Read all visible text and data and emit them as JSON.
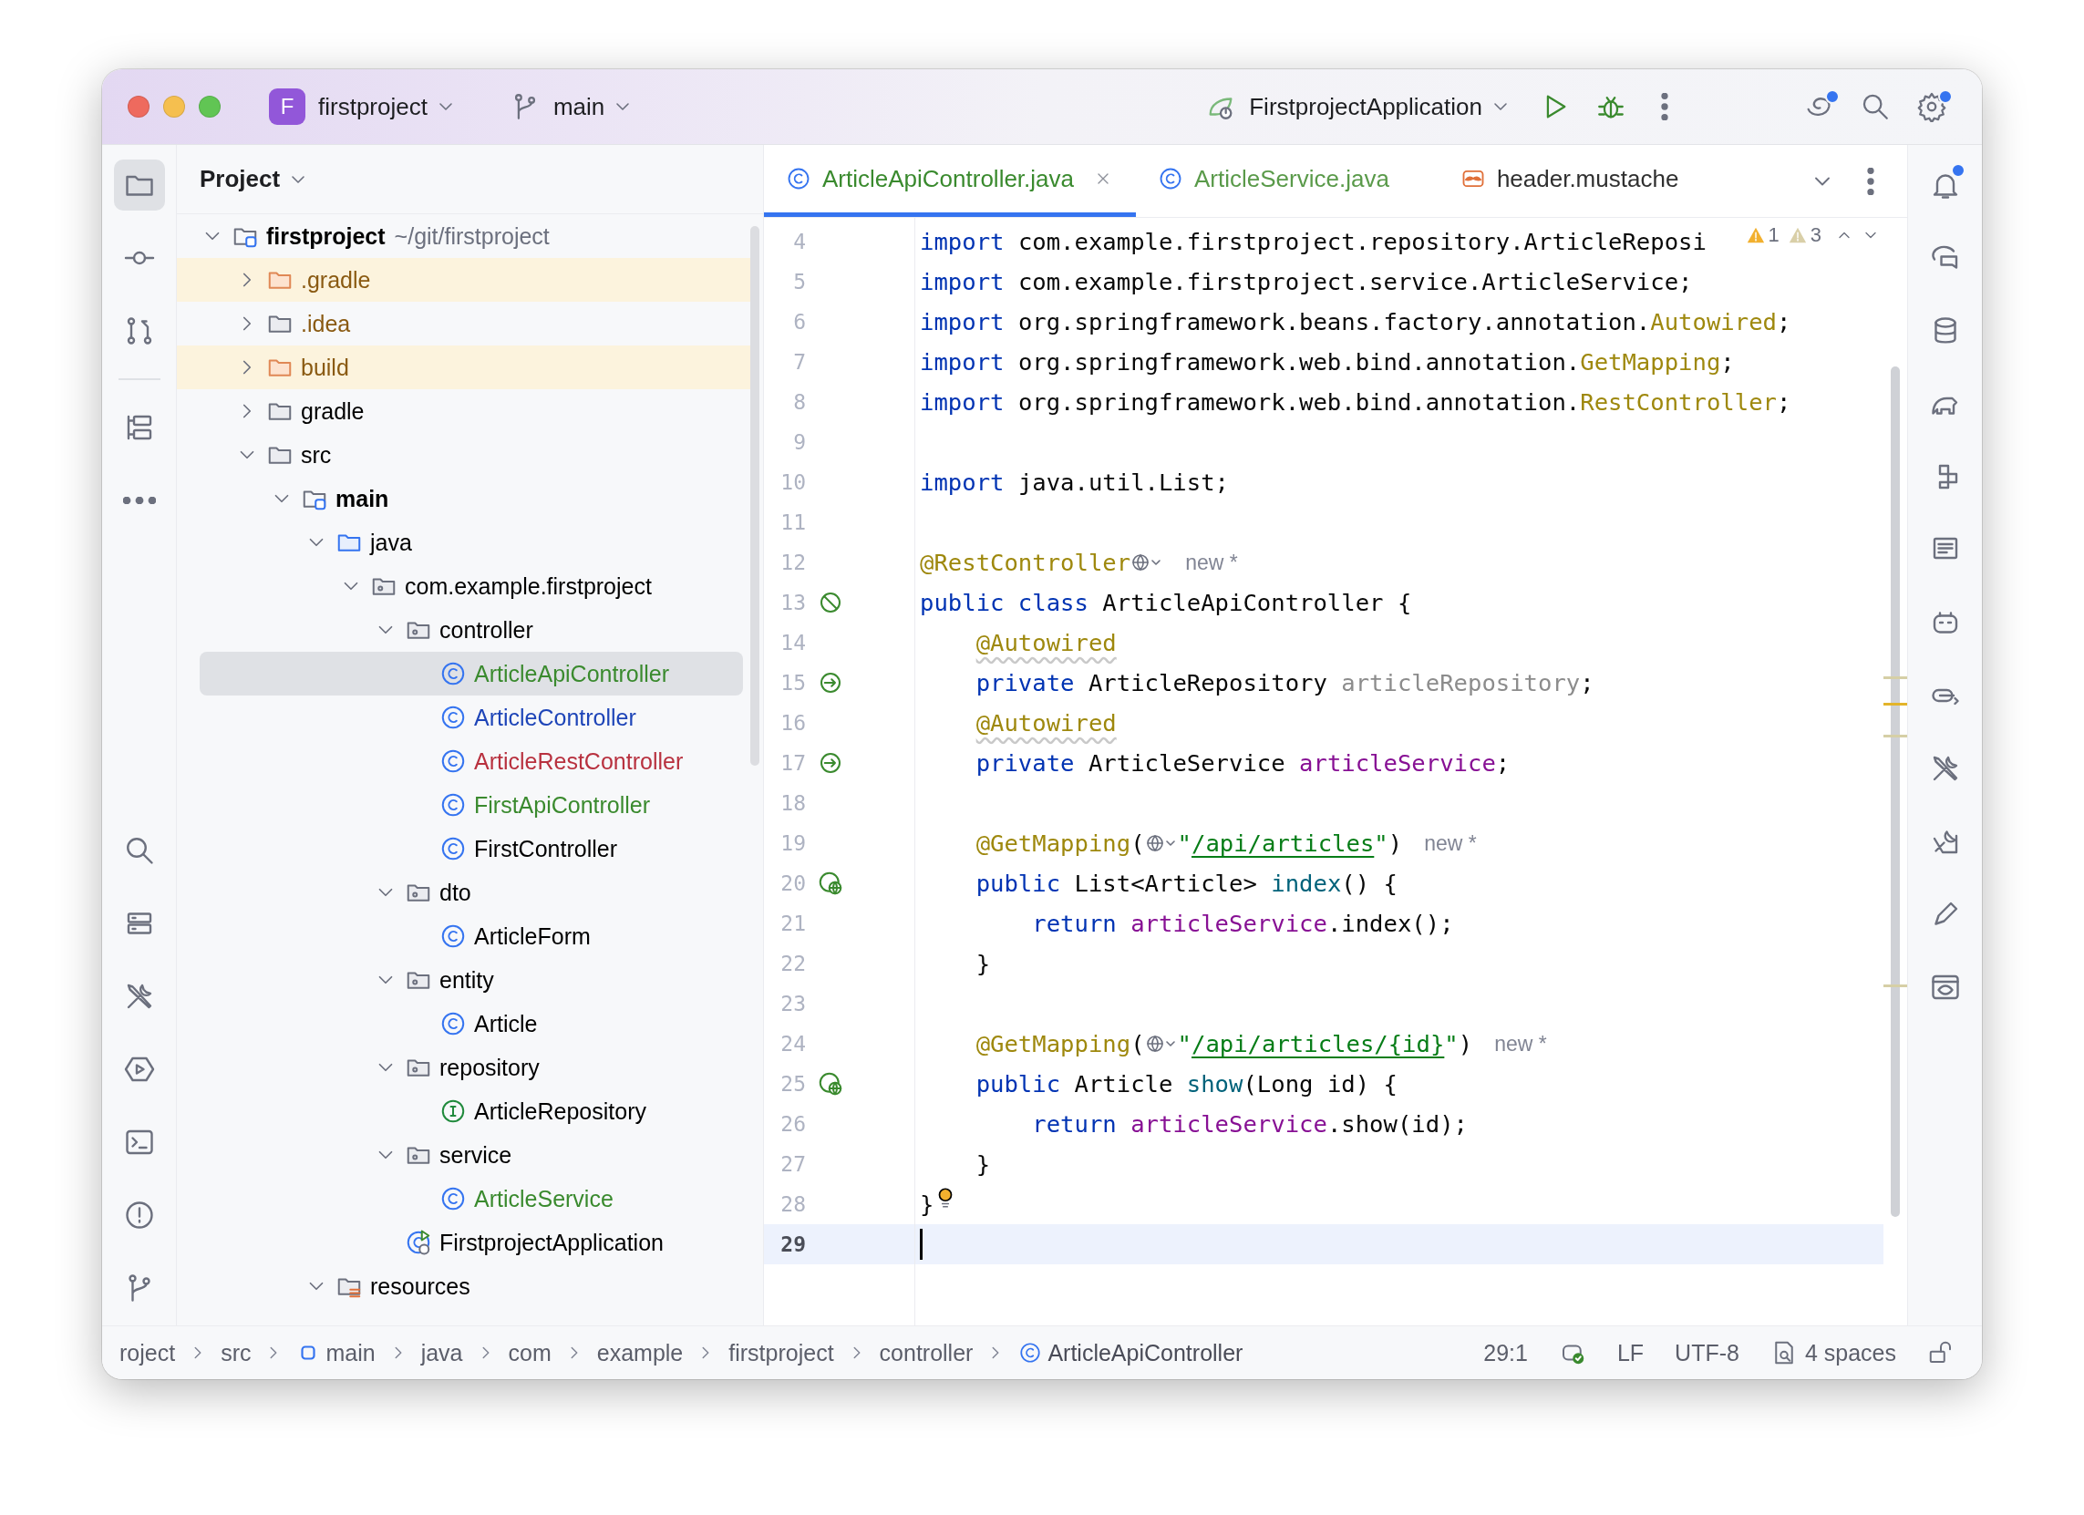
{
  "window": {
    "project_badge": "F",
    "project": "firstproject",
    "branch": "main",
    "run_config": "FirstprojectApplication"
  },
  "project_panel": {
    "title": "Project",
    "tree": [
      {
        "label": "firstproject",
        "path": "~/git/firstproject",
        "kind": "module",
        "expanded": true,
        "selected": false,
        "color": "#000000",
        "children": [
          {
            "label": ".gradle",
            "kind": "excluded-folder",
            "expanded": false,
            "selected": false,
            "color": "#8a5a12"
          },
          {
            "label": ".idea",
            "kind": "folder",
            "expanded": false,
            "selected": false,
            "color": "#8a5a12"
          },
          {
            "label": "build",
            "kind": "excluded-folder",
            "expanded": false,
            "selected": false,
            "color": "#8a5a12"
          },
          {
            "label": "gradle",
            "kind": "folder",
            "expanded": false,
            "selected": false,
            "color": "#000000"
          },
          {
            "label": "src",
            "kind": "folder",
            "expanded": true,
            "selected": false,
            "color": "#000000",
            "children": [
              {
                "label": "main",
                "kind": "module",
                "expanded": true,
                "selected": false,
                "color": "#000000",
                "children": [
                  {
                    "label": "java",
                    "kind": "source-folder",
                    "expanded": true,
                    "selected": false,
                    "color": "#000000",
                    "children": [
                      {
                        "label": "com.example.firstproject",
                        "kind": "package",
                        "expanded": true,
                        "selected": false,
                        "color": "#000000",
                        "children": [
                          {
                            "label": "controller",
                            "kind": "package",
                            "expanded": true,
                            "selected": false,
                            "color": "#000000",
                            "children": [
                              {
                                "label": "ArticleApiController",
                                "kind": "class",
                                "selected": true,
                                "color": "#3a8a2e"
                              },
                              {
                                "label": "ArticleController",
                                "kind": "class",
                                "selected": false,
                                "color": "#1e45b8"
                              },
                              {
                                "label": "ArticleRestController",
                                "kind": "class",
                                "selected": false,
                                "color": "#b8313f"
                              },
                              {
                                "label": "FirstApiController",
                                "kind": "class",
                                "selected": false,
                                "color": "#3a8a2e"
                              },
                              {
                                "label": "FirstController",
                                "kind": "class",
                                "selected": false,
                                "color": "#000000"
                              }
                            ]
                          },
                          {
                            "label": "dto",
                            "kind": "package",
                            "expanded": true,
                            "selected": false,
                            "color": "#000000",
                            "children": [
                              {
                                "label": "ArticleForm",
                                "kind": "class",
                                "selected": false,
                                "color": "#000000"
                              }
                            ]
                          },
                          {
                            "label": "entity",
                            "kind": "package",
                            "expanded": true,
                            "selected": false,
                            "color": "#000000",
                            "children": [
                              {
                                "label": "Article",
                                "kind": "class",
                                "selected": false,
                                "color": "#000000"
                              }
                            ]
                          },
                          {
                            "label": "repository",
                            "kind": "package",
                            "expanded": true,
                            "selected": false,
                            "color": "#000000",
                            "children": [
                              {
                                "label": "ArticleRepository",
                                "kind": "interface",
                                "selected": false,
                                "color": "#000000"
                              }
                            ]
                          },
                          {
                            "label": "service",
                            "kind": "package",
                            "expanded": true,
                            "selected": false,
                            "color": "#000000",
                            "children": [
                              {
                                "label": "ArticleService",
                                "kind": "class",
                                "selected": false,
                                "color": "#3a8a2e"
                              }
                            ]
                          },
                          {
                            "label": "FirstprojectApplication",
                            "kind": "app",
                            "selected": false,
                            "color": "#000000"
                          }
                        ]
                      }
                    ]
                  },
                  {
                    "label": "resources",
                    "kind": "resources",
                    "expanded": true,
                    "selected": false,
                    "color": "#000000"
                  }
                ]
              }
            ]
          }
        ]
      }
    ]
  },
  "editor": {
    "tabs": [
      {
        "label": "ArticleApiController.java",
        "kind": "class",
        "color": "#3a8a2e",
        "selected": true
      },
      {
        "label": "ArticleService.java",
        "kind": "class",
        "color": "#5a9a4a",
        "selected": false
      },
      {
        "label": "header.mustache",
        "kind": "mustache",
        "color": "#303030",
        "selected": false
      }
    ],
    "inspections": [
      {
        "kind": "warning",
        "count": "1"
      },
      {
        "kind": "weak-warning",
        "count": "3"
      }
    ],
    "lines": [
      {
        "number": "4",
        "current": false,
        "tokens": [
          {
            "kind": "kw",
            "text": "import"
          },
          {
            "kind": "plain",
            "text": " com.example.firstproject.repository.ArticleReposi"
          }
        ]
      },
      {
        "number": "5",
        "current": false,
        "tokens": [
          {
            "kind": "kw",
            "text": "import"
          },
          {
            "kind": "plain",
            "text": " com.example.firstproject.service.ArticleService;"
          }
        ]
      },
      {
        "number": "6",
        "current": false,
        "tokens": [
          {
            "kind": "kw",
            "text": "import"
          },
          {
            "kind": "plain",
            "text": " org.springframework.beans.factory.annotation."
          },
          {
            "kind": "ann",
            "text": "Autowired"
          },
          {
            "kind": "plain",
            "text": ";"
          }
        ]
      },
      {
        "number": "7",
        "current": false,
        "tokens": [
          {
            "kind": "kw",
            "text": "import"
          },
          {
            "kind": "plain",
            "text": " org.springframework.web.bind.annotation."
          },
          {
            "kind": "ann",
            "text": "GetMapping"
          },
          {
            "kind": "plain",
            "text": ";"
          }
        ]
      },
      {
        "number": "8",
        "current": false,
        "tokens": [
          {
            "kind": "kw",
            "text": "import"
          },
          {
            "kind": "plain",
            "text": " org.springframework.web.bind.annotation."
          },
          {
            "kind": "ann",
            "text": "RestController"
          },
          {
            "kind": "plain",
            "text": ";"
          }
        ]
      },
      {
        "number": "9",
        "current": false
      },
      {
        "number": "10",
        "current": false,
        "tokens": [
          {
            "kind": "kw",
            "text": "import"
          },
          {
            "kind": "plain",
            "text": " java.util.List;"
          }
        ]
      },
      {
        "number": "11",
        "current": false
      },
      {
        "number": "12",
        "current": false,
        "tokens": [
          {
            "kind": "ann",
            "text": "@RestController"
          },
          {
            "kind": "globe"
          },
          {
            "kind": "hint",
            "text": "new *"
          }
        ]
      },
      {
        "number": "13",
        "current": false,
        "gutter": {
          "kind": "bean"
        },
        "tokens": [
          {
            "kind": "kw",
            "text": "public class"
          },
          {
            "kind": "plain",
            "text": " ArticleApiController {"
          }
        ]
      },
      {
        "number": "14",
        "current": false,
        "tokens": [
          {
            "kind": "ann-warn",
            "text": "    @Autowired"
          }
        ]
      },
      {
        "number": "15",
        "current": false,
        "gutter": {
          "kind": "autowired"
        },
        "tokens": [
          {
            "kind": "kw",
            "text": "    private"
          },
          {
            "kind": "plain",
            "text": " ArticleRepository "
          },
          {
            "kind": "field-unused",
            "text": "articleRepository"
          },
          {
            "kind": "plain",
            "text": ";"
          }
        ]
      },
      {
        "number": "16",
        "current": false,
        "tokens": [
          {
            "kind": "ann-warn",
            "text": "    @Autowired"
          }
        ]
      },
      {
        "number": "17",
        "current": false,
        "gutter": {
          "kind": "autowired"
        },
        "tokens": [
          {
            "kind": "kw",
            "text": "    private"
          },
          {
            "kind": "plain",
            "text": " ArticleService "
          },
          {
            "kind": "field",
            "text": "articleService"
          },
          {
            "kind": "plain",
            "text": ";"
          }
        ]
      },
      {
        "number": "18",
        "current": false
      },
      {
        "number": "19",
        "current": false,
        "tokens": [
          {
            "kind": "ann",
            "text": "    @GetMapping"
          },
          {
            "kind": "plain",
            "text": "("
          },
          {
            "kind": "globe"
          },
          {
            "kind": "str",
            "text": "\""
          },
          {
            "kind": "link",
            "text": "/api/articles"
          },
          {
            "kind": "str",
            "text": "\""
          },
          {
            "kind": "plain",
            "text": ")"
          },
          {
            "kind": "hint",
            "text": "new *"
          }
        ]
      },
      {
        "number": "20",
        "current": false,
        "gutter": {
          "kind": "endpoint"
        },
        "tokens": [
          {
            "kind": "kw",
            "text": "    public"
          },
          {
            "kind": "plain",
            "text": " List<Article> "
          },
          {
            "kind": "method",
            "text": "index"
          },
          {
            "kind": "plain",
            "text": "() {"
          }
        ]
      },
      {
        "number": "21",
        "current": false,
        "tokens": [
          {
            "kind": "kw",
            "text": "        return"
          },
          {
            "kind": "field",
            "text": " articleService"
          },
          {
            "kind": "plain",
            "text": ".index();"
          }
        ]
      },
      {
        "number": "22",
        "current": false,
        "tokens": [
          {
            "kind": "plain",
            "text": "    }"
          }
        ]
      },
      {
        "number": "23",
        "current": false
      },
      {
        "number": "24",
        "current": false,
        "tokens": [
          {
            "kind": "ann",
            "text": "    @GetMapping"
          },
          {
            "kind": "plain",
            "text": "("
          },
          {
            "kind": "globe"
          },
          {
            "kind": "str",
            "text": "\""
          },
          {
            "kind": "link",
            "text": "/api/articles/{id}"
          },
          {
            "kind": "str",
            "text": "\""
          },
          {
            "kind": "plain",
            "text": ")"
          },
          {
            "kind": "hint",
            "text": "new *"
          }
        ]
      },
      {
        "number": "25",
        "current": false,
        "gutter": {
          "kind": "endpoint"
        },
        "tokens": [
          {
            "kind": "kw",
            "text": "    public"
          },
          {
            "kind": "plain",
            "text": " Article "
          },
          {
            "kind": "method",
            "text": "show"
          },
          {
            "kind": "plain",
            "text": "(Long id) {"
          }
        ]
      },
      {
        "number": "26",
        "current": false,
        "tokens": [
          {
            "kind": "kw",
            "text": "        return"
          },
          {
            "kind": "field",
            "text": " articleService"
          },
          {
            "kind": "plain",
            "text": ".show(id);"
          }
        ]
      },
      {
        "number": "27",
        "current": false,
        "tokens": [
          {
            "kind": "plain",
            "text": "    }"
          }
        ]
      },
      {
        "number": "28",
        "current": false,
        "tokens": [
          {
            "kind": "plain",
            "text": "}"
          },
          {
            "kind": "bulb"
          }
        ]
      },
      {
        "number": "29",
        "current": true,
        "tokens": [
          {
            "kind": "caret"
          }
        ]
      }
    ]
  },
  "breadcrumbs": [
    {
      "label": "roject",
      "kind": "folder"
    },
    {
      "label": "src",
      "kind": "folder"
    },
    {
      "label": "main",
      "kind": "module"
    },
    {
      "label": "java",
      "kind": "folder"
    },
    {
      "label": "com",
      "kind": "folder"
    },
    {
      "label": "example",
      "kind": "folder"
    },
    {
      "label": "firstproject",
      "kind": "folder"
    },
    {
      "label": "controller",
      "kind": "folder"
    },
    {
      "label": "ArticleApiController",
      "kind": "class"
    }
  ],
  "status_bar": {
    "position": "29:1",
    "line_separator": "LF",
    "encoding": "UTF-8",
    "indent": "4 spaces"
  }
}
